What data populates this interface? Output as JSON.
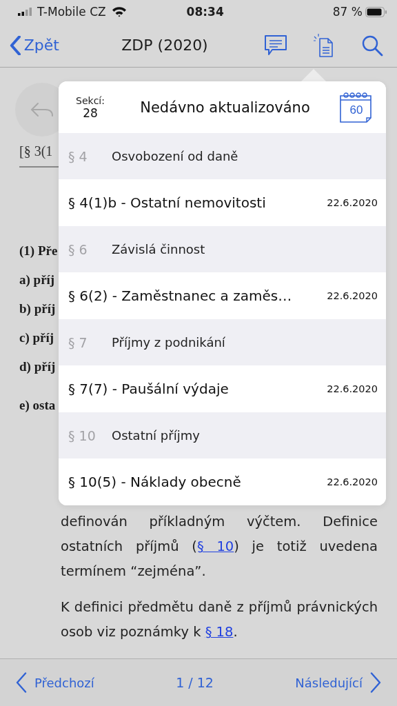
{
  "status_bar": {
    "carrier": "T-Mobile CZ",
    "time": "08:34",
    "battery": "87 %"
  },
  "nav": {
    "back_label": "Zpět",
    "title": "ZDP (2020)"
  },
  "document": {
    "reference": "[§ 3(1",
    "lines": [
      "(1) Pře",
      "a) příj",
      "b) příj",
      "c) příj",
      "d) příj",
      "e) osta"
    ],
    "paragraphs": [
      {
        "before": "definován příkladným výčtem. Definice ostatních příjmů (",
        "link": "§ 10",
        "after": ") je totiž uvedena termínem “zejména”."
      },
      {
        "before": "K definici předmětu daně z příjmů právnických osob viz poznámky k ",
        "link": "§ 18",
        "after": "."
      }
    ]
  },
  "popover": {
    "count_label": "Sekcí:",
    "count": "28",
    "title": "Nedávno aktualizováno",
    "calendar_days": "60",
    "rows": [
      {
        "kind": "section",
        "number": "§ 4",
        "title": "Osvobození od daně"
      },
      {
        "kind": "item",
        "title": "§ 4(1)b - Ostatní nemovitosti",
        "date": "22.6.2020"
      },
      {
        "kind": "section",
        "number": "§ 6",
        "title": "Závislá činnost"
      },
      {
        "kind": "item",
        "title": "§ 6(2) - Zaměstnanec a zaměs…",
        "date": "22.6.2020"
      },
      {
        "kind": "section",
        "number": "§ 7",
        "title": "Příjmy z podnikání"
      },
      {
        "kind": "item",
        "title": "§ 7(7) - Paušální výdaje",
        "date": "22.6.2020"
      },
      {
        "kind": "section",
        "number": "§ 10",
        "title": "Ostatní příjmy"
      },
      {
        "kind": "item",
        "title": "§ 10(5) - Náklady obecně",
        "date": "22.6.2020"
      }
    ]
  },
  "bottom_bar": {
    "previous": "Předchozí",
    "page": "1 / 12",
    "next": "Následující"
  }
}
